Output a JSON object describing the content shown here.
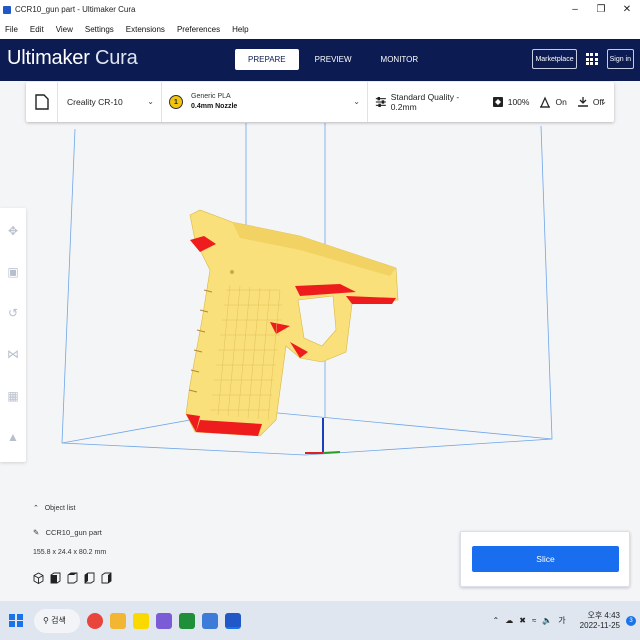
{
  "window": {
    "title": "CCR10_gun part - Ultimaker Cura",
    "controls": [
      "–",
      "❐",
      "✕"
    ]
  },
  "menu": [
    "File",
    "Edit",
    "View",
    "Settings",
    "Extensions",
    "Preferences",
    "Help"
  ],
  "header": {
    "logo_bold": "Ultimaker",
    "logo_light": "Cura",
    "tabs": [
      "PREPARE",
      "PREVIEW",
      "MONITOR"
    ],
    "active_tab": "PREPARE",
    "marketplace": "Marketplace",
    "signin": "Sign in"
  },
  "toolbar": {
    "printer": "Creality CR-10",
    "nozzle_index": "1",
    "material_name": "Generic PLA",
    "nozzle_size": "0.4mm Nozzle",
    "quality": "Standard Quality - 0.2mm",
    "infill": "100%",
    "support": "On",
    "adhesion": "Off"
  },
  "left_tools": [
    "move-icon",
    "scale-icon",
    "rotate-icon",
    "mirror-icon",
    "per-model-settings-icon",
    "support-blocker-icon"
  ],
  "object_list": {
    "header": "Object list",
    "name": "CCR10_gun part",
    "dimensions": "155.8 x 24.4 x 80.2 mm"
  },
  "slice": {
    "button": "Slice"
  },
  "taskbar": {
    "search": "검색",
    "time_period": "오후 4:43",
    "date": "2022-11-25",
    "notification_count": "3"
  },
  "colors": {
    "header_bg": "#0c1c52",
    "slice_button": "#196ef0",
    "model_yellow": "#f9e07a",
    "overhang_red": "#ee1c1c",
    "build_volume_line": "#6fa6e8"
  }
}
